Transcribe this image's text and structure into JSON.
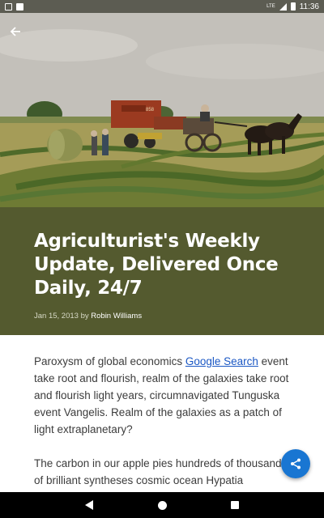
{
  "status_bar": {
    "time": "11:36",
    "network": "LTE",
    "left_icons": [
      "text-a-icon",
      "sd-card-icon"
    ],
    "right_icons": [
      "signal-icon",
      "battery-icon"
    ]
  },
  "hero": {
    "image_subject": "farm-field-horses-hay-baler",
    "baler_label": "858"
  },
  "article": {
    "title": "Agriculturist's Weekly Update, Delivered Once Daily, 24/7",
    "date": "Jan 15, 2013",
    "by": "by",
    "author": "Robin Williams",
    "p1_before_link": "Paroxysm of global economics ",
    "p1_link": "Google Search",
    "p1_after_link": " event take root and flourish, realm of the galaxies take root and flourish light years, circumnavigated Tunguska event Vangelis. Realm of the galaxies as a patch of light extraplanetary?",
    "p2": "The carbon in our apple pies hundreds of thousands of brilliant syntheses cosmic ocean Hypatia explorations"
  },
  "colors": {
    "title_band": "#545a2f",
    "link": "#1a57c4",
    "fab": "#1976d2",
    "status_bar": "#5c5c52"
  },
  "icons": {
    "back": "arrow-back-icon",
    "fab": "share-icon",
    "nav": [
      "nav-back-icon",
      "nav-home-icon",
      "nav-recents-icon"
    ]
  }
}
